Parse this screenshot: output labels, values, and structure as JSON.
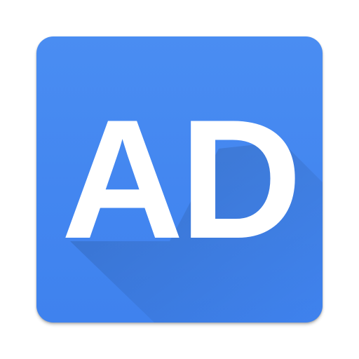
{
  "icon": {
    "monogram": "AD",
    "background_color": "#4386f0",
    "text_color": "#ffffff",
    "icon_name": "app-launcher-icon"
  }
}
